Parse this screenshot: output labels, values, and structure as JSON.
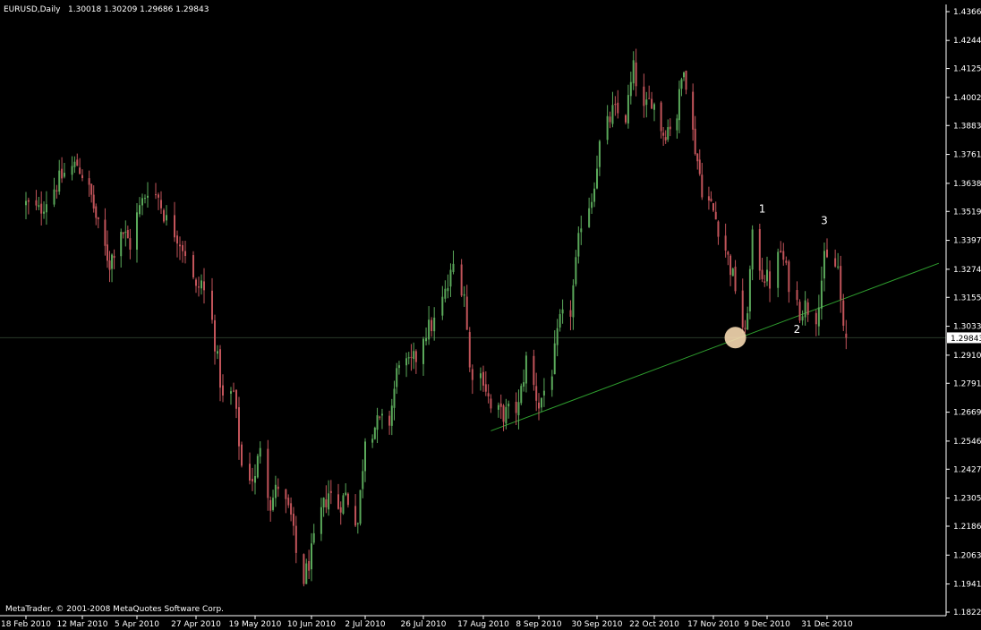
{
  "header": {
    "symbol": "EURUSD,Daily",
    "ohlc": "1.30018 1.30209 1.29686 1.29843"
  },
  "footer": {
    "copyright": "MetaTrader, © 2001-2008 MetaQuotes Software Corp."
  },
  "colors": {
    "background": "#000000",
    "bull": "#5aa85a",
    "bear": "#c2545a",
    "axis": "#ffffff",
    "trendline": "#2e9e2e",
    "current_price_line": "#2a3a2a",
    "highlight": "#f5d8b0"
  },
  "annotations": [
    {
      "text": "1",
      "date": "7 Dec 2010",
      "price": 1.353
    },
    {
      "text": "2",
      "date": "20 Dec 2010",
      "price": 1.302
    },
    {
      "text": "3",
      "date": "30 Dec 2010",
      "price": 1.348
    }
  ],
  "chart_data": {
    "type": "candlestick",
    "symbol": "EURUSD",
    "timeframe": "Daily",
    "y_ticks": [
      "1.43660",
      "1.42440",
      "1.41250",
      "1.40025",
      "1.38835",
      "1.37610",
      "1.36385",
      "1.35195",
      "1.33970",
      "1.32745",
      "1.31555",
      "1.30330",
      "1.29105",
      "1.27915",
      "1.26690",
      "1.25465",
      "1.24275",
      "1.23050",
      "1.21860",
      "1.20635",
      "1.19410",
      "1.18220"
    ],
    "x_ticks": [
      "18 Feb 2010",
      "12 Mar 2010",
      "5 Apr 2010",
      "27 Apr 2010",
      "19 May 2010",
      "10 Jun 2010",
      "2 Jul 2010",
      "26 Jul 2010",
      "17 Aug 2010",
      "8 Sep 2010",
      "30 Sep 2010",
      "22 Oct 2010",
      "17 Nov 2010",
      "9 Dec 2010",
      "31 Dec 2010"
    ],
    "current_price": "1.29843",
    "ylim": [
      1.1822,
      1.4366
    ],
    "trendline": [
      {
        "date": "20 Aug 2010",
        "price": 1.259
      },
      {
        "date": "~10 Feb 2011",
        "price": 1.33
      }
    ],
    "highlight_circle": {
      "date": "26 Nov 2010",
      "price": 1.2985
    },
    "close_path": [
      [
        "18 Feb 2010",
        1.355
      ],
      [
        "23 Feb 2010",
        1.352
      ],
      [
        "1 Mar 2010",
        1.362
      ],
      [
        "5 Mar 2010",
        1.368
      ],
      [
        "10 Mar 2010",
        1.372
      ],
      [
        "12 Mar 2010",
        1.368
      ],
      [
        "16 Mar 2010",
        1.358
      ],
      [
        "19 Mar 2010",
        1.345
      ],
      [
        "24 Mar 2010",
        1.33
      ],
      [
        "29 Mar 2010",
        1.345
      ],
      [
        "2 Apr 2010",
        1.338
      ],
      [
        "5 Apr 2010",
        1.35
      ],
      [
        "9 Apr 2010",
        1.362
      ],
      [
        "13 Apr 2010",
        1.358
      ],
      [
        "16 Apr 2010",
        1.348
      ],
      [
        "20 Apr 2010",
        1.342
      ],
      [
        "23 Apr 2010",
        1.335
      ],
      [
        "27 Apr 2010",
        1.318
      ],
      [
        "29 Apr 2010",
        1.322
      ],
      [
        "3 May 2010",
        1.305
      ],
      [
        "7 May 2010",
        1.272
      ],
      [
        "11 May 2010",
        1.275
      ],
      [
        "14 May 2010",
        1.244
      ],
      [
        "19 May 2010",
        1.238
      ],
      [
        "21 May 2010",
        1.254
      ],
      [
        "25 May 2010",
        1.228
      ],
      [
        "28 May 2010",
        1.236
      ],
      [
        "2 Jun 2010",
        1.222
      ],
      [
        "4 Jun 2010",
        1.207
      ],
      [
        "7 Jun 2010",
        1.196
      ],
      [
        "10 Jun 2010",
        1.207
      ],
      [
        "14 Jun 2010",
        1.224
      ],
      [
        "17 Jun 2010",
        1.233
      ],
      [
        "21 Jun 2010",
        1.227
      ],
      [
        "24 Jun 2010",
        1.232
      ],
      [
        "29 Jun 2010",
        1.22
      ],
      [
        "2 Jul 2010",
        1.257
      ],
      [
        "7 Jul 2010",
        1.262
      ],
      [
        "12 Jul 2010",
        1.263
      ],
      [
        "16 Jul 2010",
        1.29
      ],
      [
        "20 Jul 2010",
        1.286
      ],
      [
        "23 Jul 2010",
        1.29
      ],
      [
        "26 Jul 2010",
        1.3
      ],
      [
        "30 Jul 2010",
        1.305
      ],
      [
        "4 Aug 2010",
        1.32
      ],
      [
        "6 Aug 2010",
        1.329
      ],
      [
        "10 Aug 2010",
        1.318
      ],
      [
        "12 Aug 2010",
        1.285
      ],
      [
        "17 Aug 2010",
        1.282
      ],
      [
        "20 Aug 2010",
        1.268
      ],
      [
        "25 Aug 2010",
        1.266
      ],
      [
        "31 Aug 2010",
        1.269
      ],
      [
        "3 Sep 2010",
        1.289
      ],
      [
        "8 Sep 2010",
        1.27
      ],
      [
        "13 Sep 2010",
        1.285
      ],
      [
        "16 Sep 2010",
        1.305
      ],
      [
        "20 Sep 2010",
        1.31
      ],
      [
        "24 Sep 2010",
        1.348
      ],
      [
        "28 Sep 2010",
        1.358
      ],
      [
        "1 Oct 2010",
        1.38
      ],
      [
        "6 Oct 2010",
        1.394
      ],
      [
        "11 Oct 2010",
        1.392
      ],
      [
        "14 Oct 2010",
        1.412
      ],
      [
        "18 Oct 2010",
        1.394
      ],
      [
        "21 Oct 2010",
        1.4
      ],
      [
        "26 Oct 2010",
        1.385
      ],
      [
        "1 Nov 2010",
        1.393
      ],
      [
        "4 Nov 2010",
        1.415
      ],
      [
        "8 Nov 2010",
        1.385
      ],
      [
        "12 Nov 2010",
        1.362
      ],
      [
        "17 Nov 2010",
        1.352
      ],
      [
        "22 Nov 2010",
        1.336
      ],
      [
        "26 Nov 2010",
        1.32
      ],
      [
        "30 Nov 2010",
        1.298
      ],
      [
        "3 Dec 2010",
        1.34
      ],
      [
        "7 Dec 2010",
        1.326
      ],
      [
        "10 Dec 2010",
        1.322
      ],
      [
        "14 Dec 2010",
        1.335
      ],
      [
        "17 Dec 2010",
        1.322
      ],
      [
        "21 Dec 2010",
        1.31
      ],
      [
        "23 Dec 2010",
        1.312
      ],
      [
        "27 Dec 2010",
        1.308
      ],
      [
        "30 Dec 2010",
        1.331
      ],
      [
        "4 Jan 2011",
        1.328
      ],
      [
        "6 Jan 2011",
        1.3
      ],
      [
        "7 Jan 2011",
        1.2984
      ]
    ]
  }
}
